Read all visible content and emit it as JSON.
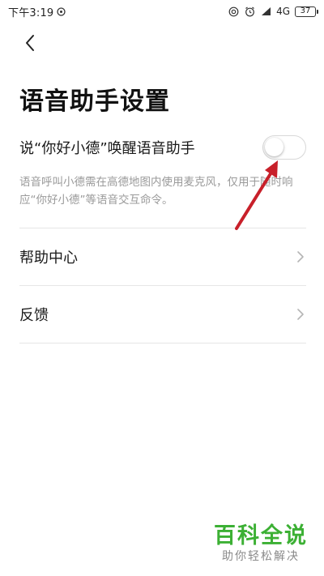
{
  "status_bar": {
    "time": "下午3:19",
    "network": "4G",
    "battery": "37"
  },
  "header": {
    "back_icon": "chevron-left-icon",
    "title": "语音助手设置"
  },
  "wake_setting": {
    "label": "说“你好小德”唤醒语音助手",
    "toggle_on": false,
    "description": "语音呼叫小德需在高德地图内使用麦克风，仅用于随时响应“你好小德”等语音交互命令。"
  },
  "menu": {
    "items": [
      {
        "label": "帮助中心",
        "icon": "chevron-right-icon"
      },
      {
        "label": "反馈",
        "icon": "chevron-right-icon"
      }
    ]
  },
  "watermark": {
    "title": "百科全说",
    "subtitle": "助你轻松解决"
  },
  "colors": {
    "annotation_arrow": "#c8202a",
    "watermark_green": "#3cb034",
    "description_gray": "#9a9a9a"
  }
}
